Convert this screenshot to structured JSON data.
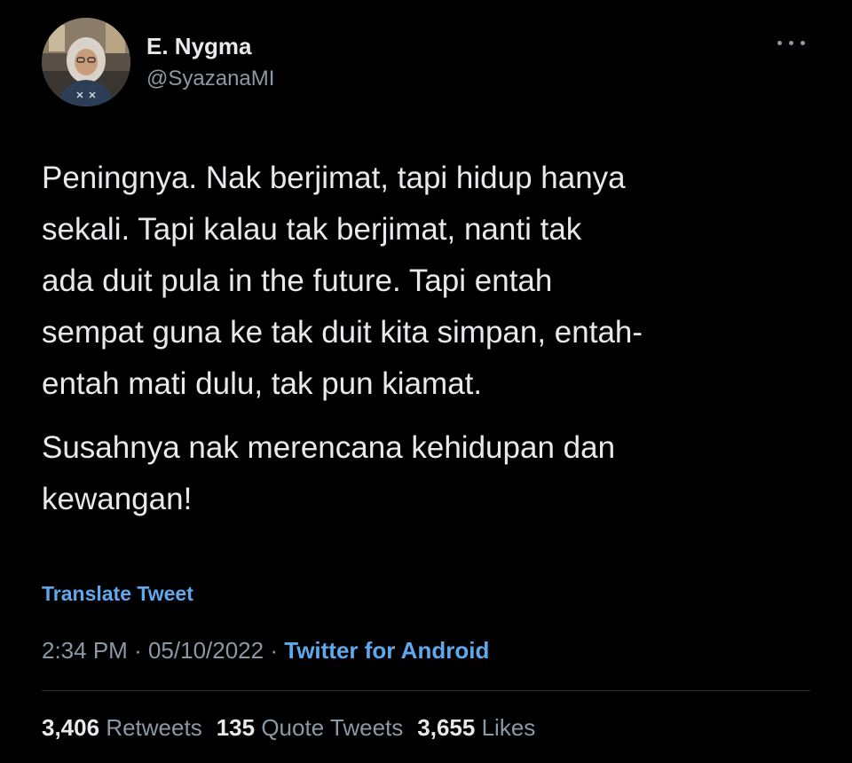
{
  "tweet": {
    "display_name": "E. Nygma",
    "handle": "@SyazanaMI",
    "more_icon": "more-horizontal-icon",
    "avatar": "profile-photo",
    "body_paragraph_1": "Peningnya. Nak berjimat, tapi hidup hanya\nsekali. Tapi kalau tak berjimat, nanti tak\nada duit pula in the future. Tapi entah\nsempat guna ke tak duit kita simpan, entah-\nentah mati dulu, tak pun kiamat.",
    "body_paragraph_2": "Susahnya nak merencana kehidupan dan\nkewangan!",
    "translate_label": "Translate Tweet",
    "time": "2:34 PM",
    "date": "05/10/2022",
    "separator": "·",
    "source": "Twitter for Android",
    "stats": {
      "retweets_count": "3,406",
      "retweets_label": "Retweets",
      "quotes_count": "135",
      "quotes_label": "Quote Tweets",
      "likes_count": "3,655",
      "likes_label": "Likes"
    }
  },
  "colors": {
    "background": "#000000",
    "text_primary": "#e7e9ea",
    "text_secondary": "#8b98a5",
    "link": "#5fa8ec",
    "divider": "#2f3336"
  }
}
